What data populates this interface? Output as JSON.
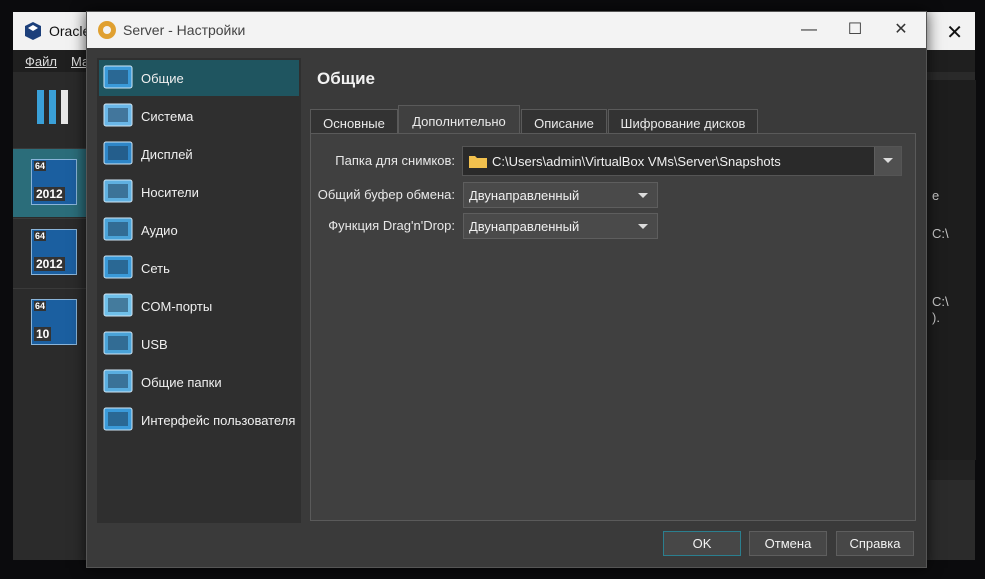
{
  "background_window": {
    "title": "Oracle",
    "menu": [
      "Файл",
      "Ма"
    ],
    "vms": [
      {
        "bits": "64",
        "os": "2012",
        "selected": true
      },
      {
        "bits": "64",
        "os": "2012",
        "selected": false
      },
      {
        "bits": "64",
        "os": "10",
        "selected": false
      }
    ],
    "right_fragments": [
      "e",
      "C:\\",
      "C:\\",
      ")."
    ]
  },
  "dialog": {
    "title": "Server - Настройки",
    "buttons": {
      "minimize": "—",
      "maximize": "☐",
      "close": "✕"
    }
  },
  "sidebar": {
    "items": [
      {
        "label": "Общие",
        "icon": "general-icon",
        "active": true
      },
      {
        "label": "Система",
        "icon": "system-icon"
      },
      {
        "label": "Дисплей",
        "icon": "display-icon"
      },
      {
        "label": "Носители",
        "icon": "storage-icon"
      },
      {
        "label": "Аудио",
        "icon": "audio-icon"
      },
      {
        "label": "Сеть",
        "icon": "network-icon"
      },
      {
        "label": "COM-порты",
        "icon": "serial-ports-icon"
      },
      {
        "label": "USB",
        "icon": "usb-icon"
      },
      {
        "label": "Общие папки",
        "icon": "shared-folders-icon"
      },
      {
        "label": "Интерфейс пользователя",
        "icon": "user-interface-icon"
      }
    ]
  },
  "page": {
    "title": "Общие",
    "tabs": [
      "Основные",
      "Дополнительно",
      "Описание",
      "Шифрование дисков"
    ],
    "active_tab": "Дополнительно",
    "fields": {
      "snapshot_folder": {
        "label": "Папка для снимков:",
        "value": "C:\\Users\\admin\\VirtualBox VMs\\Server\\Snapshots"
      },
      "clipboard": {
        "label": "Общий буфер обмена:",
        "value": "Двунаправленный"
      },
      "dragdrop": {
        "label": "Функция Drag'n'Drop:",
        "value": "Двунаправленный"
      }
    }
  },
  "footer": {
    "ok": "OK",
    "cancel": "Отмена",
    "help": "Справка"
  },
  "colors": {
    "accent": "#1f5560",
    "dialog_bg": "#3a3a3a",
    "panel_bg": "#404040"
  }
}
